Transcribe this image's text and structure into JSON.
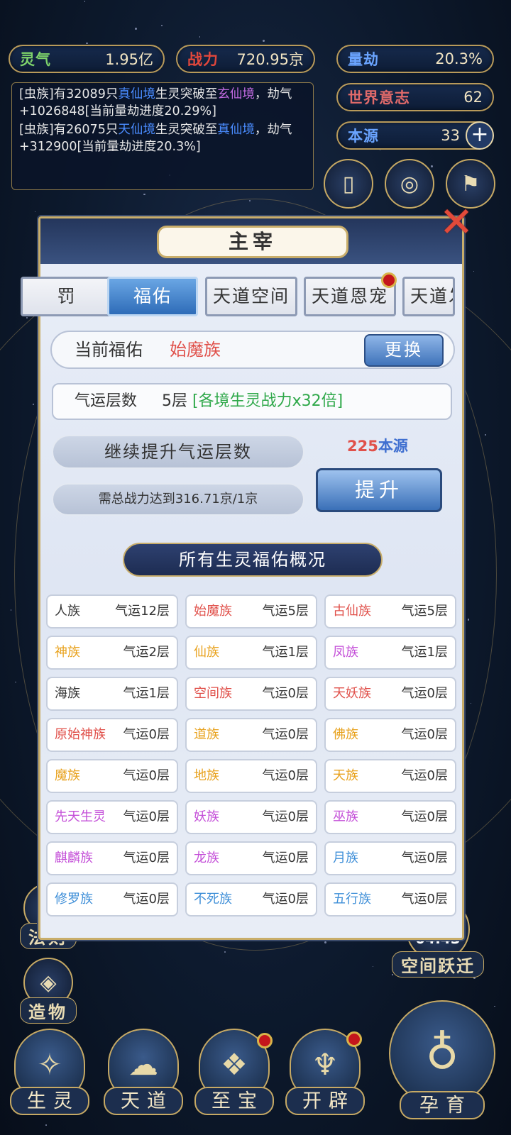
{
  "stats": {
    "lingqi": {
      "label": "灵气",
      "value": "1.95亿",
      "color": "#7ed36b"
    },
    "zhanli": {
      "label": "战力",
      "value": "720.95京",
      "color": "#e2473b"
    },
    "liangjie": {
      "label": "量劫",
      "value": "20.3%",
      "color": "#6aa4ff"
    },
    "shijie": {
      "label": "世界意志",
      "value": "62",
      "color": "#e06a6a"
    },
    "benyuan": {
      "label": "本源",
      "value": "33",
      "color": "#6aa4ff"
    }
  },
  "log": {
    "entries": [
      {
        "p1": "[虫族]有32089只",
        "a": "真仙境",
        "p2": "生灵突破至",
        "b": "玄仙境",
        "p3": "，劫气+1026848[当前量劫进度20.29%]"
      },
      {
        "p1": "[虫族]有26075只",
        "a": "天仙境",
        "p2": "生灵突破至",
        "b": "真仙境",
        "p3": "，劫气+312900[当前量劫进度20.3%]"
      }
    ]
  },
  "side": {
    "left": [
      "法则",
      "造物"
    ],
    "right": [
      "空间跃迁"
    ],
    "timer": "04:43"
  },
  "bottom_nav": [
    "生灵",
    "天道",
    "至宝",
    "开辟",
    "孕育"
  ],
  "modal": {
    "title": "主宰",
    "tabs": [
      "罚",
      "福佑",
      "天道空间",
      "天道恩宠",
      "天道发"
    ],
    "current_label": "当前福佑",
    "current_value": "始魔族",
    "swap_label": "更换",
    "luck_label": "气运层数",
    "luck_value": "5层",
    "luck_effect": "[各境生灵战力x32倍]",
    "continue_label": "继续提升气运层数",
    "requirement": "需总战力达到316.71京/1京",
    "cost_amount": "225",
    "cost_unit": "本源",
    "upgrade_label": "提升",
    "overview_label": "所有生灵福佑概况",
    "races": [
      {
        "name": "人族",
        "level": "气运12层",
        "color": "#333333"
      },
      {
        "name": "始魔族",
        "level": "气运5层",
        "color": "#e0504a"
      },
      {
        "name": "古仙族",
        "level": "气运5层",
        "color": "#e0504a"
      },
      {
        "name": "神族",
        "level": "气运2层",
        "color": "#e8a21e"
      },
      {
        "name": "仙族",
        "level": "气运1层",
        "color": "#e8a21e"
      },
      {
        "name": "凤族",
        "level": "气运1层",
        "color": "#c44fd8"
      },
      {
        "name": "海族",
        "level": "气运1层",
        "color": "#333333"
      },
      {
        "name": "空间族",
        "level": "气运0层",
        "color": "#e0504a"
      },
      {
        "name": "天妖族",
        "level": "气运0层",
        "color": "#e0504a"
      },
      {
        "name": "原始神族",
        "level": "气运0层",
        "color": "#e0504a"
      },
      {
        "name": "道族",
        "level": "气运0层",
        "color": "#e8a21e"
      },
      {
        "name": "佛族",
        "level": "气运0层",
        "color": "#e8a21e"
      },
      {
        "name": "魔族",
        "level": "气运0层",
        "color": "#e8a21e"
      },
      {
        "name": "地族",
        "level": "气运0层",
        "color": "#e8a21e"
      },
      {
        "name": "天族",
        "level": "气运0层",
        "color": "#e8a21e"
      },
      {
        "name": "先天生灵",
        "level": "气运0层",
        "color": "#c44fd8"
      },
      {
        "name": "妖族",
        "level": "气运0层",
        "color": "#c44fd8"
      },
      {
        "name": "巫族",
        "level": "气运0层",
        "color": "#c44fd8"
      },
      {
        "name": "麒麟族",
        "level": "气运0层",
        "color": "#c44fd8"
      },
      {
        "name": "龙族",
        "level": "气运0层",
        "color": "#c44fd8"
      },
      {
        "name": "月族",
        "level": "气运0层",
        "color": "#3f8fd8"
      },
      {
        "name": "修罗族",
        "level": "气运0层",
        "color": "#3f8fd8"
      },
      {
        "name": "不死族",
        "level": "气运0层",
        "color": "#3f8fd8"
      },
      {
        "name": "五行族",
        "level": "气运0层",
        "color": "#3f8fd8"
      }
    ]
  }
}
